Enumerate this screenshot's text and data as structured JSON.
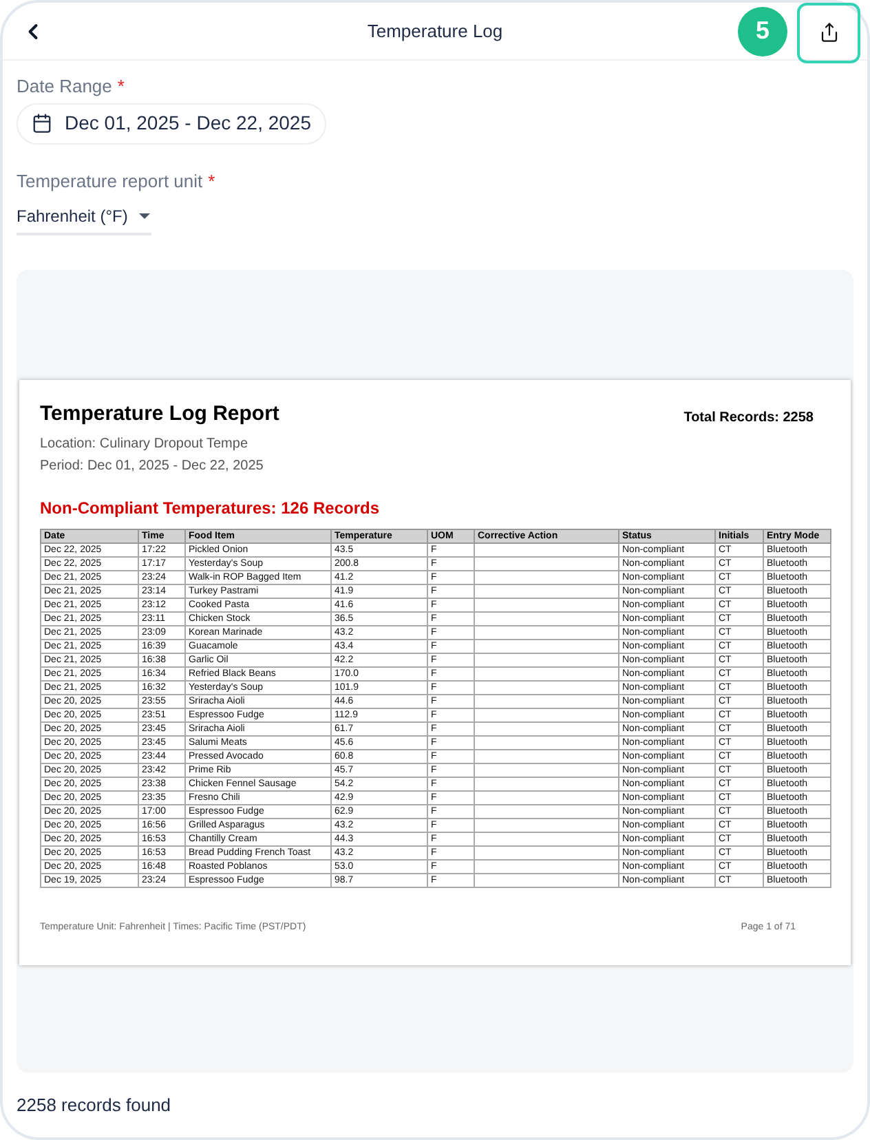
{
  "header": {
    "title": "Temperature Log",
    "badge": "5"
  },
  "date_range": {
    "label": "Date Range",
    "required_mark": "*",
    "value": "Dec 01, 2025 - Dec 22, 2025"
  },
  "unit": {
    "label": "Temperature report unit",
    "required_mark": "*",
    "value": "Fahrenheit (°F)"
  },
  "report": {
    "title": "Temperature Log Report",
    "total": "Total Records: 2258",
    "location": "Location: Culinary Dropout Tempe",
    "period": "Period: Dec 01, 2025 - Dec 22, 2025",
    "alert": "Non-Compliant Temperatures: 126 Records",
    "table": {
      "columns": [
        "Date",
        "Time",
        "Food Item",
        "Temperature",
        "UOM",
        "Corrective Action",
        "Status",
        "Initials",
        "Entry Mode"
      ],
      "rows": [
        {
          "date": "Dec 22, 2025",
          "time": "17:22",
          "food_item": "Pickled Onion",
          "temperature": "43.5",
          "uom": "F",
          "status": "Non-compliant",
          "initials": "CT",
          "entry_mode": "Bluetooth"
        },
        {
          "date": "Dec 22, 2025",
          "time": "17:17",
          "food_item": "Yesterday's Soup",
          "temperature": "200.8",
          "uom": "F",
          "status": "Non-compliant",
          "initials": "CT",
          "entry_mode": "Bluetooth"
        },
        {
          "date": "Dec 21, 2025",
          "time": "23:24",
          "food_item": "Walk-in ROP Bagged Item",
          "temperature": "41.2",
          "uom": "F",
          "status": "Non-compliant",
          "initials": "CT",
          "entry_mode": "Bluetooth"
        },
        {
          "date": "Dec 21, 2025",
          "time": "23:14",
          "food_item": "Turkey Pastrami",
          "temperature": "41.9",
          "uom": "F",
          "status": "Non-compliant",
          "initials": "CT",
          "entry_mode": "Bluetooth"
        },
        {
          "date": "Dec 21, 2025",
          "time": "23:12",
          "food_item": "Cooked Pasta",
          "temperature": "41.6",
          "uom": "F",
          "status": "Non-compliant",
          "initials": "CT",
          "entry_mode": "Bluetooth"
        },
        {
          "date": "Dec 21, 2025",
          "time": "23:11",
          "food_item": "Chicken Stock",
          "temperature": "36.5",
          "uom": "F",
          "status": "Non-compliant",
          "initials": "CT",
          "entry_mode": "Bluetooth"
        },
        {
          "date": "Dec 21, 2025",
          "time": "23:09",
          "food_item": "Korean Marinade",
          "temperature": "43.2",
          "uom": "F",
          "status": "Non-compliant",
          "initials": "CT",
          "entry_mode": "Bluetooth"
        },
        {
          "date": "Dec 21, 2025",
          "time": "16:39",
          "food_item": "Guacamole",
          "temperature": "43.4",
          "uom": "F",
          "status": "Non-compliant",
          "initials": "CT",
          "entry_mode": "Bluetooth"
        },
        {
          "date": "Dec 21, 2025",
          "time": "16:38",
          "food_item": "Garlic Oil",
          "temperature": "42.2",
          "uom": "F",
          "status": "Non-compliant",
          "initials": "CT",
          "entry_mode": "Bluetooth"
        },
        {
          "date": "Dec 21, 2025",
          "time": "16:34",
          "food_item": "Refried Black Beans",
          "temperature": "170.0",
          "uom": "F",
          "status": "Non-compliant",
          "initials": "CT",
          "entry_mode": "Bluetooth"
        },
        {
          "date": "Dec 21, 2025",
          "time": "16:32",
          "food_item": "Yesterday's Soup",
          "temperature": "101.9",
          "uom": "F",
          "status": "Non-compliant",
          "initials": "CT",
          "entry_mode": "Bluetooth"
        },
        {
          "date": "Dec 20, 2025",
          "time": "23:55",
          "food_item": "Sriracha Aioli",
          "temperature": "44.6",
          "uom": "F",
          "status": "Non-compliant",
          "initials": "CT",
          "entry_mode": "Bluetooth"
        },
        {
          "date": "Dec 20, 2025",
          "time": "23:51",
          "food_item": "Espressoo Fudge",
          "temperature": "112.9",
          "uom": "F",
          "status": "Non-compliant",
          "initials": "CT",
          "entry_mode": "Bluetooth"
        },
        {
          "date": "Dec 20, 2025",
          "time": "23:45",
          "food_item": "Sriracha Aioli",
          "temperature": "61.7",
          "uom": "F",
          "status": "Non-compliant",
          "initials": "CT",
          "entry_mode": "Bluetooth"
        },
        {
          "date": "Dec 20, 2025",
          "time": "23:45",
          "food_item": "Salumi Meats",
          "temperature": "45.6",
          "uom": "F",
          "status": "Non-compliant",
          "initials": "CT",
          "entry_mode": "Bluetooth"
        },
        {
          "date": "Dec 20, 2025",
          "time": "23:44",
          "food_item": "Pressed Avocado",
          "temperature": "60.8",
          "uom": "F",
          "status": "Non-compliant",
          "initials": "CT",
          "entry_mode": "Bluetooth"
        },
        {
          "date": "Dec 20, 2025",
          "time": "23:42",
          "food_item": "Prime Rib",
          "temperature": "45.7",
          "uom": "F",
          "status": "Non-compliant",
          "initials": "CT",
          "entry_mode": "Bluetooth"
        },
        {
          "date": "Dec 20, 2025",
          "time": "23:38",
          "food_item": "Chicken Fennel Sausage",
          "temperature": "54.2",
          "uom": "F",
          "status": "Non-compliant",
          "initials": "CT",
          "entry_mode": "Bluetooth"
        },
        {
          "date": "Dec 20, 2025",
          "time": "23:35",
          "food_item": "Fresno Chili",
          "temperature": "42.9",
          "uom": "F",
          "status": "Non-compliant",
          "initials": "CT",
          "entry_mode": "Bluetooth"
        },
        {
          "date": "Dec 20, 2025",
          "time": "17:00",
          "food_item": "Espressoo Fudge",
          "temperature": "62.9",
          "uom": "F",
          "status": "Non-compliant",
          "initials": "CT",
          "entry_mode": "Bluetooth"
        },
        {
          "date": "Dec 20, 2025",
          "time": "16:56",
          "food_item": "Grilled Asparagus",
          "temperature": "43.2",
          "uom": "F",
          "status": "Non-compliant",
          "initials": "CT",
          "entry_mode": "Bluetooth"
        },
        {
          "date": "Dec 20, 2025",
          "time": "16:53",
          "food_item": "Chantilly Cream",
          "temperature": "44.3",
          "uom": "F",
          "status": "Non-compliant",
          "initials": "CT",
          "entry_mode": "Bluetooth"
        },
        {
          "date": "Dec 20, 2025",
          "time": "16:53",
          "food_item": "Bread Pudding French Toast",
          "temperature": "43.2",
          "uom": "F",
          "status": "Non-compliant",
          "initials": "CT",
          "entry_mode": "Bluetooth"
        },
        {
          "date": "Dec 20, 2025",
          "time": "16:48",
          "food_item": "Roasted Poblanos",
          "temperature": "53.0",
          "uom": "F",
          "status": "Non-compliant",
          "initials": "CT",
          "entry_mode": "Bluetooth"
        },
        {
          "date": "Dec 19, 2025",
          "time": "23:24",
          "food_item": "Espressoo Fudge",
          "temperature": "98.7",
          "uom": "F",
          "status": "Non-compliant",
          "initials": "CT",
          "entry_mode": "Bluetooth"
        }
      ]
    },
    "footer_note": "Temperature Unit: Fahrenheit | Times: Pacific Time (PST/PDT)",
    "page": "Page 1 of 71"
  },
  "status_bar": "2258 records found"
}
